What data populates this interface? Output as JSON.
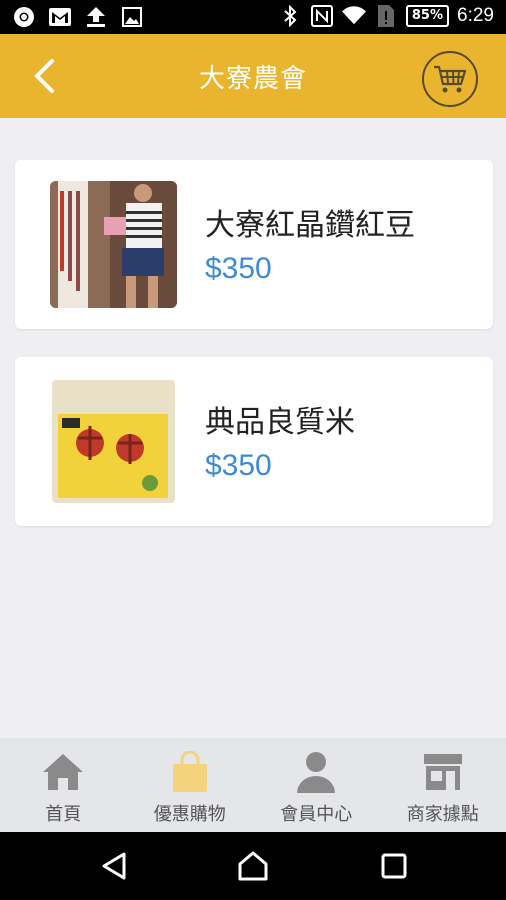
{
  "status_bar": {
    "battery": "85%",
    "time": "6:29"
  },
  "header": {
    "title": "大寮農會"
  },
  "products": [
    {
      "name": "大寮紅晶鑽紅豆",
      "price": "$350"
    },
    {
      "name": "典品良質米",
      "price": "$350"
    }
  ],
  "tabs": [
    {
      "label": "首頁",
      "icon": "home-icon"
    },
    {
      "label": "優惠購物",
      "icon": "shopping-bag-icon",
      "active": true
    },
    {
      "label": "會員中心",
      "icon": "person-icon"
    },
    {
      "label": "商家據點",
      "icon": "store-icon"
    }
  ],
  "colors": {
    "accent": "#e9b52f",
    "price": "#3d8bd6",
    "tab_inactive_icon": "#8a8a8a",
    "tab_active_icon": "#f3d47d"
  }
}
